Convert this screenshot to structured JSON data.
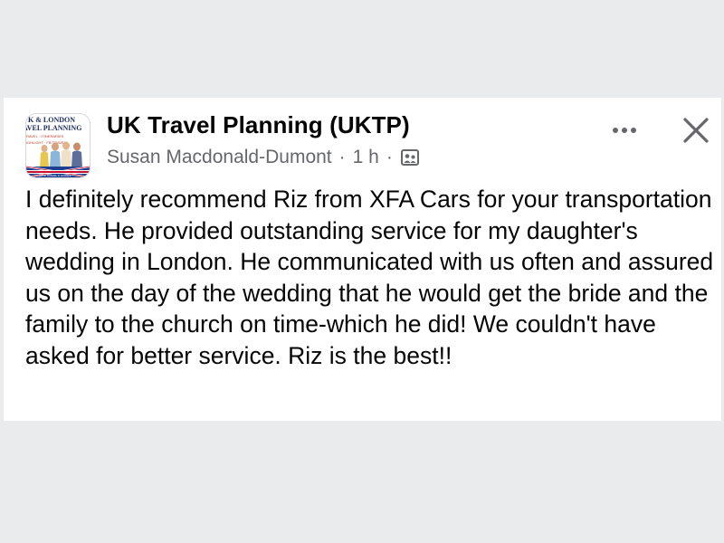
{
  "post": {
    "group_name": "UK Travel Planning (UKTP)",
    "author": "Susan Macdonald-Dumont",
    "separator": "·",
    "time": "1 h",
    "privacy_icon": "group-members-icon",
    "body": "I definitely recommend Riz from XFA Cars for your transportation needs.  He provided outstanding service for my daughter's wedding in London.  He communicated with us often and assured us on the day of the wedding that he would get the bride and the family to the church on time-which he did! We couldn't have asked for better service. Riz is the best!!"
  },
  "avatar": {
    "line1": "K & LONDON",
    "line2": "AVEL PLANNING",
    "line3": "RAVEL · ITINERARIES",
    "line4": "IGHLIGHT · FB TRAVEL",
    "footer": "UKTP TRAVEL & GUIDES"
  },
  "actions": {
    "more_icon": "more-options-icon",
    "close_icon": "close-icon"
  },
  "colors": {
    "background": "#eaebed",
    "card": "#ffffff",
    "primary_text": "#050505",
    "secondary_text": "#65676b"
  }
}
